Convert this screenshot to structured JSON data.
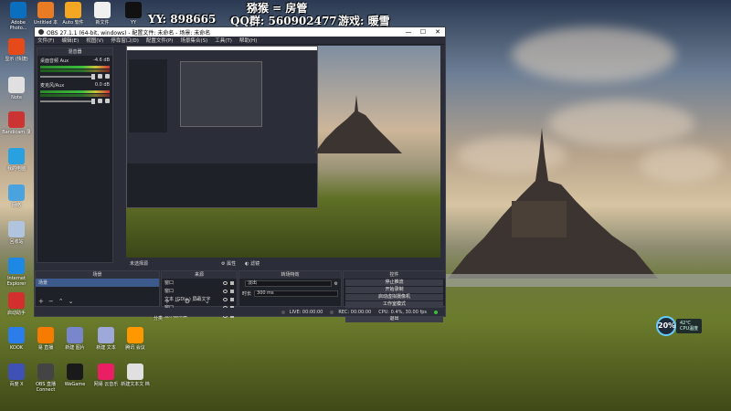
{
  "overlay": {
    "yy": "YY: 898665",
    "qq": "QQ群: 560902477",
    "game": "游戏: 暖雪",
    "title": "猕猴 = 房管"
  },
  "desktop_icons": [
    {
      "label": "Adobe Photo...",
      "color": "#0b6fbf"
    },
    {
      "label": "Untitled 本",
      "color": "#e87b24"
    },
    {
      "label": "Auto 软件",
      "color": "#f5a623"
    },
    {
      "label": "新文件",
      "color": "#f0f0f0"
    },
    {
      "label": "YY",
      "color": "#111"
    },
    {
      "label": "显示 (快捷)",
      "color": "#e64a19"
    },
    {
      "label": "Note",
      "color": "#e0e0e0"
    },
    {
      "label": "Bandicam 录",
      "color": "#c33"
    },
    {
      "label": "我的电脑",
      "color": "#29a0e0"
    },
    {
      "label": "网络",
      "color": "#4aa3df"
    },
    {
      "label": "回收站",
      "color": "#b0c4de"
    },
    {
      "label": "Internet Explorer",
      "color": "#1e88e5"
    },
    {
      "label": "启动助手",
      "color": "#d32f2f"
    },
    {
      "label": "KOOK",
      "color": "#2b7de9"
    },
    {
      "label": "易 直播",
      "color": "#f57c00"
    },
    {
      "label": "新建 图片",
      "color": "#7986cb"
    },
    {
      "label": "新建 文本",
      "color": "#9fa8da"
    },
    {
      "label": "腾讯 会议",
      "color": "#ff9800"
    },
    {
      "label": "百度 X",
      "color": "#3f51b5"
    },
    {
      "label": "OBS 直播 Connect",
      "color": "#444"
    },
    {
      "label": "WeGame",
      "color": "#1a1a1a"
    },
    {
      "label": "网易 云音乐",
      "color": "#e91e63"
    },
    {
      "label": "新建文本文 档",
      "color": "#e0e0e0"
    }
  ],
  "obs": {
    "title": "OBS 27.1.1 (64-bit, windows) - 配置文件: 未命名 - 场景: 未命名",
    "menu": [
      "文件(F)",
      "编辑(E)",
      "视图(V)",
      "停靠窗口(D)",
      "配置文件(P)",
      "场景集合(S)",
      "工具(T)",
      "帮助(H)"
    ],
    "mixer": {
      "title": "混音器",
      "tracks": [
        {
          "name": "桌面音频 Aux",
          "db": "-4.6 dB"
        },
        {
          "name": "麦克风/Aux",
          "db": "0.0 dB"
        }
      ]
    },
    "preview_toolbar": {
      "left": "未选择源",
      "properties": "属性",
      "filters": "滤镜"
    },
    "docks": {
      "scenes": {
        "title": "场景",
        "items": [
          "场景"
        ]
      },
      "sources": {
        "title": "来源",
        "items": [
          "窗口",
          "窗口",
          "文本 (GDI+) 屏幕文字",
          "窗口",
          "显示器采集"
        ]
      },
      "transitions": {
        "title": "转场特效",
        "type_label": "淡出",
        "duration_label": "时长",
        "duration_value": "300 ms"
      },
      "controls": {
        "title": "控件",
        "buttons": [
          "停止推流",
          "开始录制",
          "启动虚拟摄像机",
          "工作室模式",
          "设置",
          "退出"
        ]
      }
    },
    "status": {
      "live": "LIVE: 00:00:00",
      "rec": "REC: 00:00:00",
      "cpu": "CPU: 0.4%, 30.00 fps"
    }
  },
  "cpu_widget": {
    "percent": "20%",
    "temp": "42℃",
    "label": "CPU温度"
  },
  "taskbar_label": "分类"
}
